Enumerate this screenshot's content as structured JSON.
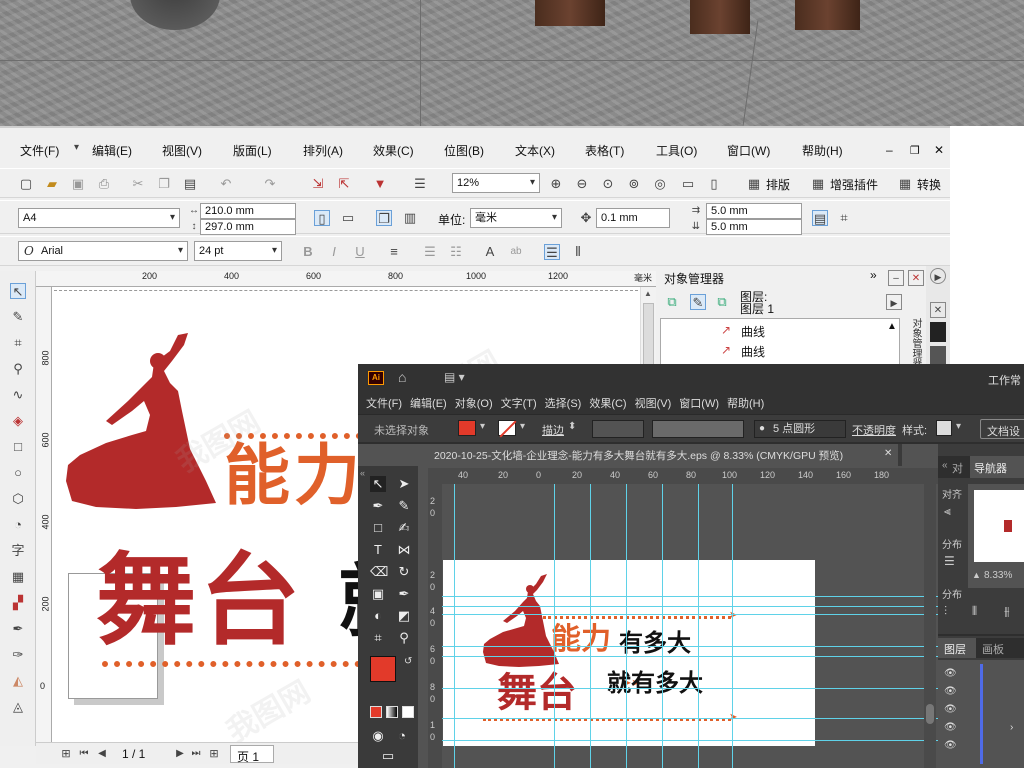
{
  "corel": {
    "menu": [
      "文件(F)",
      "编辑(E)",
      "视图(V)",
      "版面(L)",
      "排列(A)",
      "效果(C)",
      "位图(B)",
      "文本(X)",
      "表格(T)",
      "工具(O)",
      "窗口(W)",
      "帮助(H)"
    ],
    "zoom": "12%",
    "toolbar_buttons": {
      "arrange": "排版",
      "plugin": "增强插件",
      "convert": "转换"
    },
    "page_size": "A4",
    "width": "210.0 mm",
    "height": "297.0 mm",
    "unit_label": "单位:",
    "unit_value": "毫米",
    "nudge": "0.1 mm",
    "dup_x": "5.0 mm",
    "dup_y": "5.0 mm",
    "font_name": "Arial",
    "font_size": "24 pt",
    "ruler_h": [
      "200",
      "400",
      "600",
      "800",
      "1000",
      "1200"
    ],
    "ruler_h_unit": "毫米",
    "ruler_v": [
      "800",
      "600",
      "400",
      "200",
      "0"
    ],
    "page_nav": "1 / 1",
    "page_tab": "页 1",
    "obj_manager": {
      "title": "对象管理器",
      "layer_label": "图层:",
      "layer_name": "图层 1",
      "items": [
        "曲线",
        "曲线"
      ],
      "side_label": "对象管理器"
    }
  },
  "artwork": {
    "line1_orange": "能力",
    "line2_red": "舞台",
    "line2_black_partial": "就"
  },
  "ai": {
    "workspace": "工作常",
    "logo": "Ai",
    "menu": [
      "文件(F)",
      "编辑(E)",
      "对象(O)",
      "文字(T)",
      "选择(S)",
      "效果(C)",
      "视图(V)",
      "窗口(W)",
      "帮助(H)"
    ],
    "no_selection": "未选择对象",
    "stroke_label": "描边",
    "brush": "5 点圆形",
    "opacity": "不透明度",
    "style": "样式:",
    "doc_settings": "文档设",
    "doc_tab": "2020-10-25-文化墙-企业理念-能力有多大舞台就有多大.eps @ 8.33% (CMYK/GPU 预览)",
    "ruler_h": [
      "40",
      "20",
      "0",
      "20",
      "40",
      "60",
      "80",
      "100",
      "120",
      "140",
      "160",
      "180"
    ],
    "ruler_v": [
      "2",
      "0",
      "2",
      "0",
      "4",
      "0",
      "6",
      "0",
      "8",
      "0",
      "1",
      "0"
    ],
    "panel_align": "对",
    "panel_navigator": "导航器",
    "panel_align_labels": [
      "对齐",
      "分布",
      "分布"
    ],
    "navigator_zoom": "8.33%",
    "layers_tab": "图层",
    "artboard_tab": "画板",
    "art_line1_orange": "能力",
    "art_line1_black": "有多大",
    "art_line2_red": "舞台",
    "art_line2_black": "就有多大"
  },
  "colors": {
    "brand_red": "#b32a2a",
    "brand_orange": "#e0602a",
    "ai_fill": "#e23a2a",
    "guide": "#5fd2e8"
  }
}
